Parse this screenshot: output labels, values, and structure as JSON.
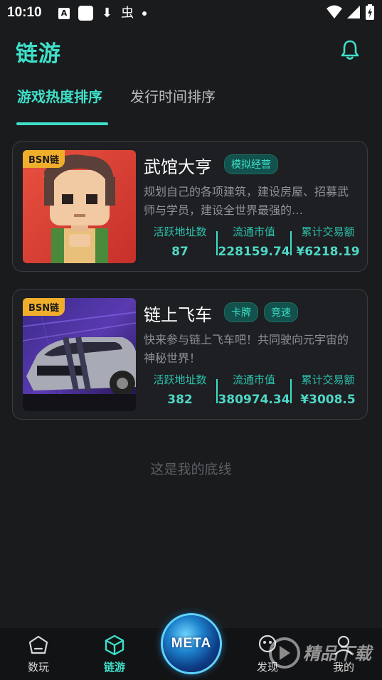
{
  "status_bar": {
    "time": "10:10",
    "a_icon": "A",
    "download_icon": "⬇",
    "bug_icon": "虫"
  },
  "header": {
    "title": "链游"
  },
  "tabs": [
    {
      "label": "游戏热度排序",
      "active": true
    },
    {
      "label": "发行时间排序",
      "active": false
    }
  ],
  "games": [
    {
      "name": "武馆大亨",
      "chain": "BSN链",
      "tags": [
        "模拟经营"
      ],
      "description": "规划自己的各项建筑，建设房屋、招募武师与学员，建设全世界最强的…",
      "stats": [
        {
          "label": "活跃地址数",
          "value": "87"
        },
        {
          "label": "流通市值",
          "value": "228159.74"
        },
        {
          "label": "累计交易额",
          "value": "¥6218.19"
        }
      ]
    },
    {
      "name": "链上飞车",
      "chain": "BSN链",
      "tags": [
        "卡牌",
        "竞速"
      ],
      "description": "快来参与链上飞车吧！共同驶向元宇宙的神秘世界！",
      "stats": [
        {
          "label": "活跃地址数",
          "value": "382"
        },
        {
          "label": "流通市值",
          "value": "380974.34"
        },
        {
          "label": "累计交易额",
          "value": "¥3008.5"
        }
      ]
    }
  ],
  "footer_text": "这是我的底线",
  "bottom_nav": {
    "items": [
      {
        "label": "数玩",
        "icon": "home-icon",
        "active": false
      },
      {
        "label": "链游",
        "icon": "cube-icon",
        "active": true
      },
      {
        "label": "发现",
        "icon": "discover-icon",
        "active": false
      },
      {
        "label": "我的",
        "icon": "profile-icon",
        "active": false
      }
    ],
    "center_button": "META"
  },
  "watermark": {
    "brand": "精品下载"
  },
  "colors": {
    "accent": "#3ee0c9",
    "background": "#1a1b1d",
    "badge": "#f0ae2b"
  }
}
